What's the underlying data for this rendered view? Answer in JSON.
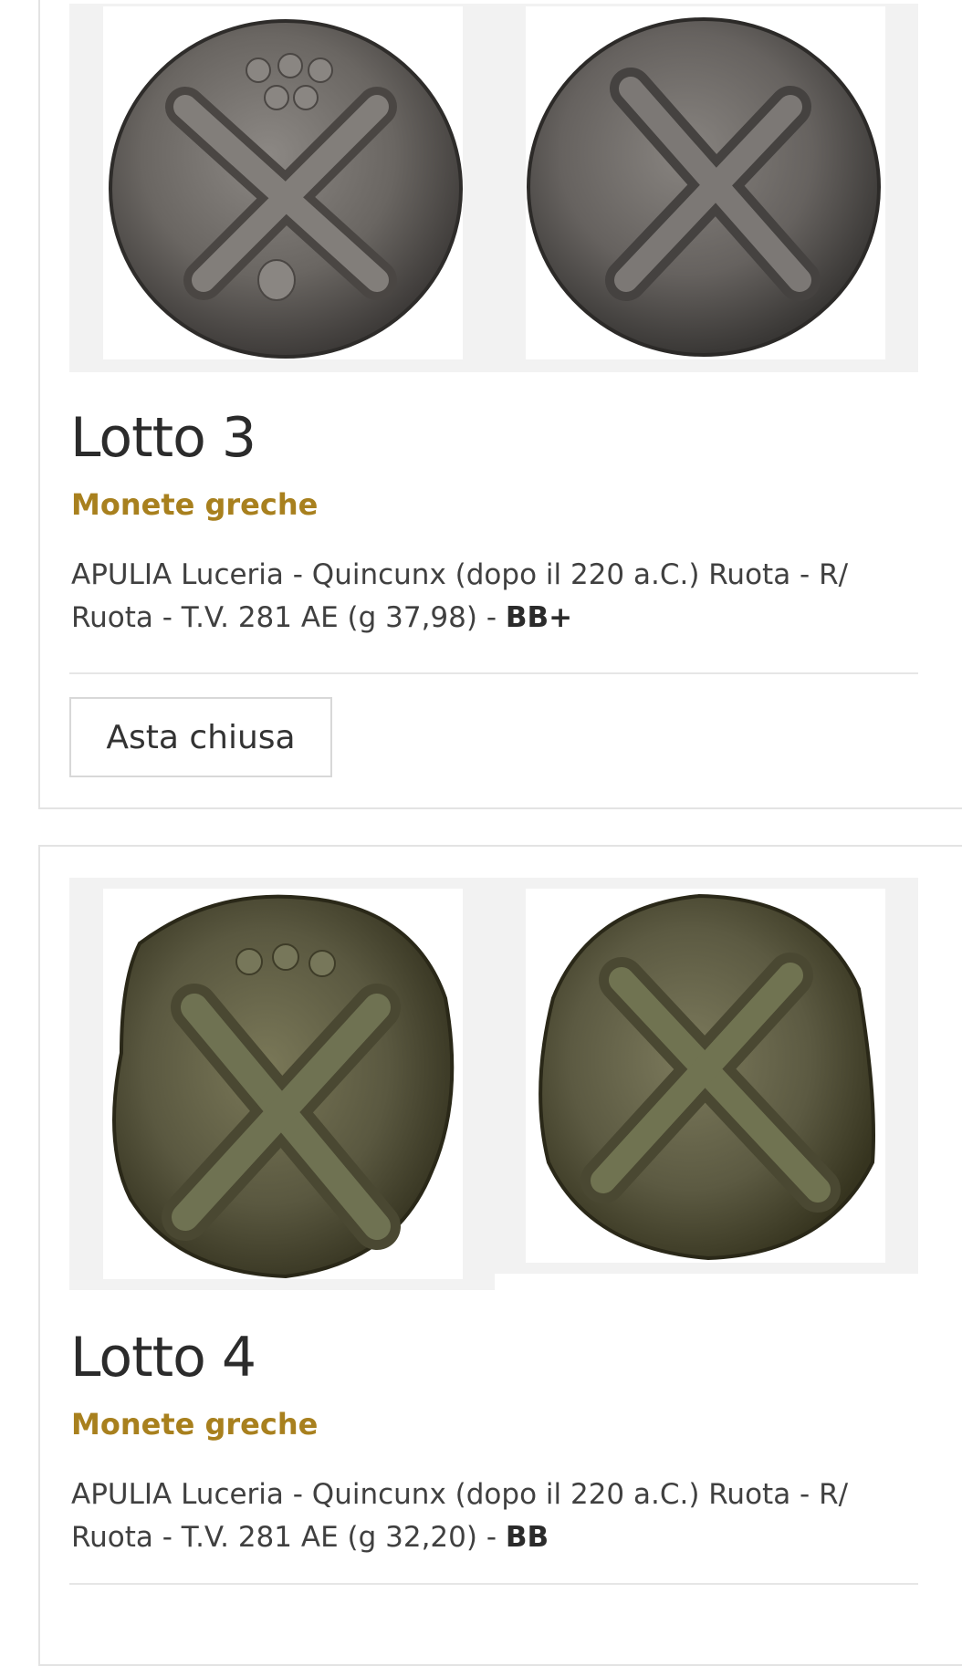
{
  "lots": [
    {
      "title": "Lotto 3",
      "category": "Monete greche",
      "description_text": "APULIA Luceria - Quincunx (dopo il 220 a.C.) Ruota - R/ Ruota - T.V. 281 AE (g 37,98) - ",
      "grade": "BB+",
      "status_button": "Asta chiusa"
    },
    {
      "title": "Lotto 4",
      "category": "Monete greche",
      "description_text": "APULIA Luceria - Quincunx (dopo il 220 a.C.) Ruota - R/ Ruota - T.V. 281 AE (g 32,20) - ",
      "grade": "BB"
    }
  ],
  "colors": {
    "category": "#a8801e",
    "border": "#e3e3e3",
    "image_bg": "#f2f2f2",
    "coin_silver": "#6e6a66",
    "coin_bronze": "#5c5a40"
  }
}
